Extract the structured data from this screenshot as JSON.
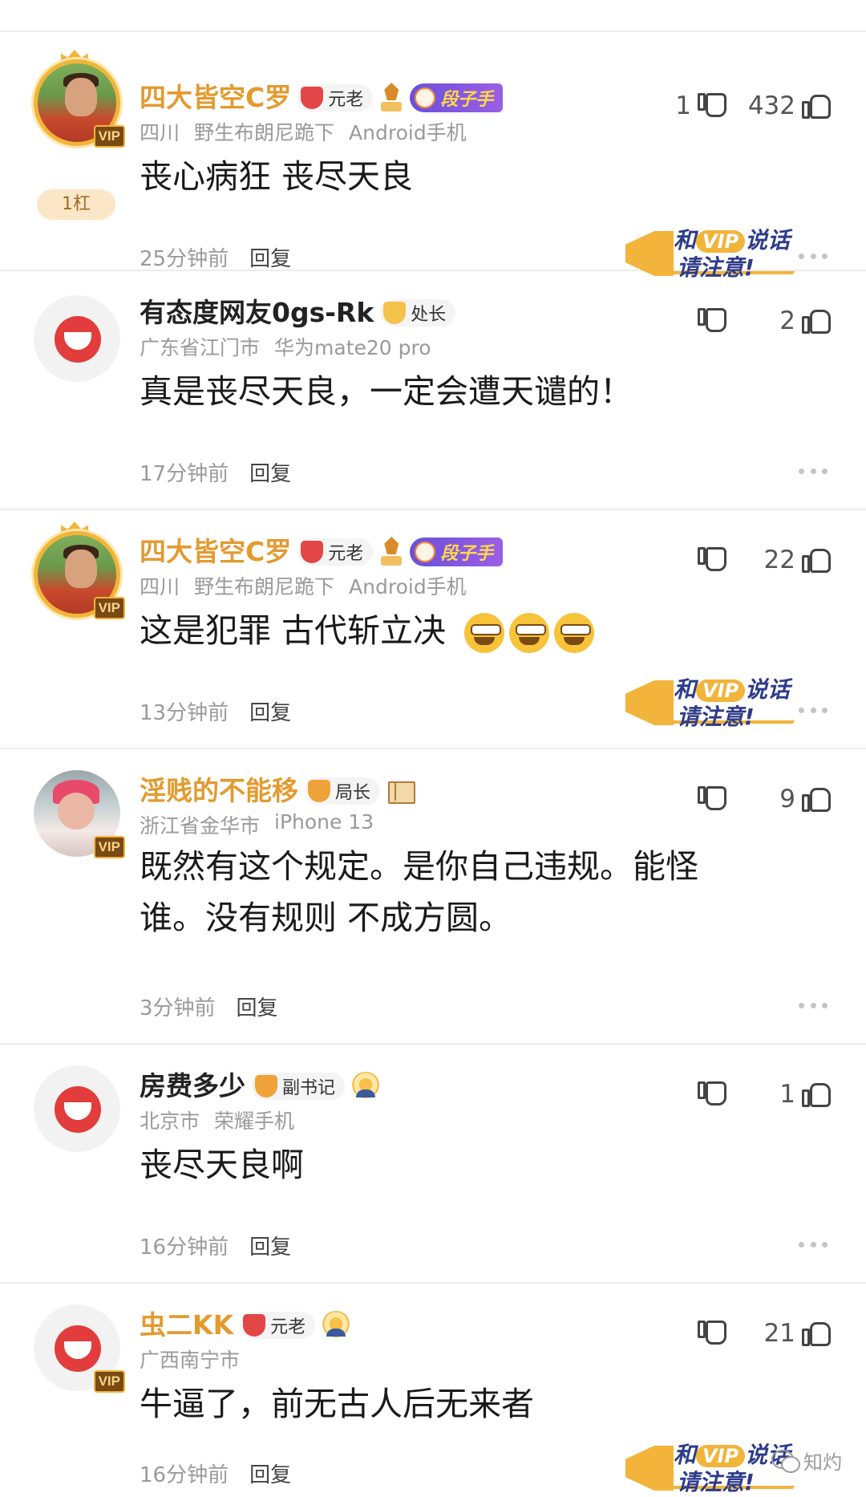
{
  "comments": [
    {
      "username": "四大皆空C罗",
      "rank": "元老",
      "title_badge": "段子手",
      "location": "四川",
      "tagline": "野生布朗尼跪下",
      "device": "Android手机",
      "content": "丧心病狂 丧尽天良",
      "time": "25分钟前",
      "downvotes": "1",
      "upvotes": "432",
      "floor": "1杠",
      "vip": "VIP"
    },
    {
      "username": "有态度网友0gs-Rk",
      "rank": "处长",
      "location": "广东省江门市",
      "device": "华为mate20 pro",
      "content": "真是丧尽天良，一定会遭天谴的！",
      "time": "17分钟前",
      "downvotes": "",
      "upvotes": "2"
    },
    {
      "username": "四大皆空C罗",
      "rank": "元老",
      "title_badge": "段子手",
      "location": "四川",
      "tagline": "野生布朗尼跪下",
      "device": "Android手机",
      "content": "这是犯罪 古代斩立决",
      "time": "13分钟前",
      "downvotes": "",
      "upvotes": "22",
      "vip": "VIP"
    },
    {
      "username": "淫贱的不能移",
      "rank": "局长",
      "location": "浙江省金华市",
      "device": "iPhone 13",
      "content_line1": "既然有这个规定。是你自己违规。能怪",
      "content_line2": "谁。没有规则 不成方圆。",
      "time": "3分钟前",
      "downvotes": "",
      "upvotes": "9",
      "vip": "VIP"
    },
    {
      "username": "房费多少",
      "rank": "副书记",
      "location": "北京市",
      "device": "荣耀手机",
      "content": "丧尽天良啊",
      "time": "16分钟前",
      "downvotes": "",
      "upvotes": "1"
    },
    {
      "username": "虫二KK",
      "rank": "元老",
      "location": "广西南宁市",
      "content": "牛逼了，前无古人后无来者",
      "time": "16分钟前",
      "downvotes": "",
      "upvotes": "21",
      "vip": "VIP"
    }
  ],
  "labels": {
    "reply": "回复",
    "vip_banner_line1_a": "和",
    "vip_banner_vip": "VIP",
    "vip_banner_line1_b": "说话",
    "vip_banner_line2": "请注意!"
  },
  "watermark": "知灼",
  "icons": [
    "thumbs-up-icon",
    "thumbs-down-icon",
    "more-icon",
    "medal-icon",
    "book-icon",
    "sun-icon",
    "wechat-icon"
  ],
  "colors": {
    "gold_name": "#e39a2f",
    "meta_gray": "#9a9a9a",
    "divider": "#ececec"
  }
}
